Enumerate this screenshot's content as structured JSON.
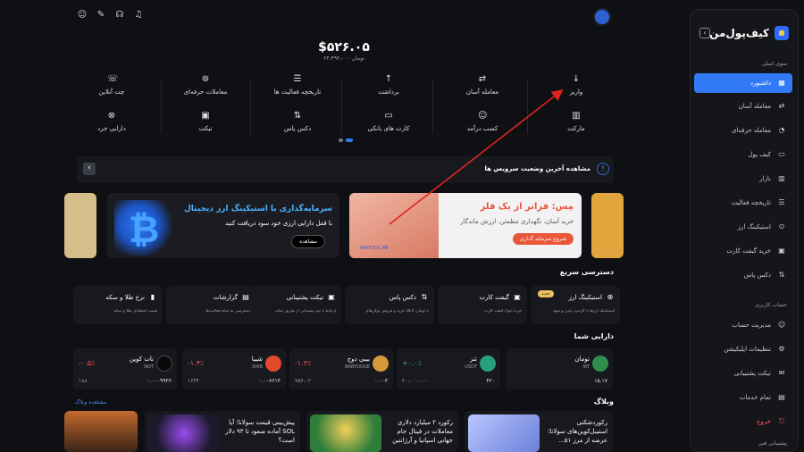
{
  "brand": {
    "name": "کیف‌پول‌من"
  },
  "sidebar": {
    "section_main": "منوی اصلی",
    "items": [
      {
        "label": "داشبورد",
        "icon": "grid-icon"
      },
      {
        "label": "معامله آسان",
        "icon": "swap-icon"
      },
      {
        "label": "معامله حرفه‌ای",
        "icon": "chart-icon"
      },
      {
        "label": "کیف پول",
        "icon": "wallet-icon"
      },
      {
        "label": "بازار",
        "icon": "market-icon"
      },
      {
        "label": "تاریخچه فعالیت",
        "icon": "history-icon"
      },
      {
        "label": "استیکینگ ارز",
        "icon": "stake-icon"
      },
      {
        "label": "خرید گیفت کارت",
        "icon": "gift-icon"
      },
      {
        "label": "دکس پاس",
        "icon": "dex-icon"
      }
    ],
    "section_account": "حساب کاربری",
    "account_items": [
      {
        "label": "مدیریت حساب",
        "icon": "user-icon"
      },
      {
        "label": "تنظیمات اپلیکیشن",
        "icon": "settings-icon"
      },
      {
        "label": "تیکت پشتیبانی",
        "icon": "ticket-icon"
      },
      {
        "label": "تمام خدمات",
        "icon": "apps-icon"
      },
      {
        "label": "خروج",
        "icon": "logout-icon"
      }
    ],
    "section_support": "پشتیبانی فنی"
  },
  "balance": {
    "main": "$۵۲۶.۰۵",
    "sub": "۶۴،۴۹۳،۰۰۰ تومان"
  },
  "actions": [
    {
      "label": "واریز",
      "icon": "arrow-down-icon"
    },
    {
      "label": "معامله آسان",
      "icon": "swap-icon"
    },
    {
      "label": "برداشت",
      "icon": "arrow-up-icon"
    },
    {
      "label": "تاریخچه فعالیت ها",
      "icon": "history-icon"
    },
    {
      "label": "معاملات حرفه‌ای",
      "icon": "pro-icon"
    },
    {
      "label": "چت آنلاین",
      "icon": "chat-icon"
    },
    {
      "label": "مارکت",
      "icon": "market-icon"
    },
    {
      "label": "کسب درآمد",
      "icon": "users-icon"
    },
    {
      "label": "کارت های بانکی",
      "icon": "card-icon"
    },
    {
      "label": "دکس پاس",
      "icon": "dex-icon"
    },
    {
      "label": "تیکت",
      "icon": "ticket-icon"
    },
    {
      "label": "دارایی خرد",
      "icon": "coin-icon"
    }
  ],
  "notice": {
    "title": "مشاهده آخرین وضعیت سرویس ها"
  },
  "banners": {
    "b1": {
      "title": "سرمایه‌گذاری با استیکینگ ارز دیجیتال",
      "sub": "با قفل دارایی ارزی خود سود دریافت کنید",
      "button": "مشاهده"
    },
    "b2": {
      "title": "مِس: فراتر از یک فلز",
      "sub": "خرید آسان، نگهداری مطمئن، ارزش ماندگار",
      "button": "شروع سرمایه گذاری",
      "mark": "RAYPOOL.ME"
    }
  },
  "quick": {
    "title": "دسترسی سریع",
    "items": [
      {
        "title": "استیکینگ ارز",
        "sub": "استیکینگ ارزها با کارمزد پایین و سود",
        "badge": "جدید",
        "icon": "stake-icon"
      },
      {
        "title": "گیفت کارت",
        "sub": "خرید انواع گیفت کارت",
        "badge": "",
        "icon": "gift-icon"
      },
      {
        "title": "دکس پاس",
        "sub": "خرید و فروش توکن‌های DEX با تومان",
        "badge": "",
        "icon": "dex-icon"
      },
      {
        "title": "تیکت پشتیبانی",
        "sub": "ارتباط با تیم پشتیبانی از طریق تیکت",
        "badge": "",
        "icon": "ticket-icon"
      },
      {
        "title": "گزارشات",
        "sub": "دسترسی به تمام فعالیت‌ها",
        "badge": "",
        "icon": "report-icon"
      },
      {
        "title": "نرخ طلا و سکه",
        "sub": "قیمت لحظه‌ای طلا و سکه",
        "badge": "",
        "icon": "gold-icon"
      }
    ]
  },
  "assets": {
    "title": "دارایی شما",
    "items": [
      {
        "name": "تومان",
        "symbol": "IRT",
        "amount": "۱۵.۱۷",
        "price": "",
        "change": "",
        "color": "#2f8f4e"
      },
      {
        "name": "تتر",
        "symbol": "USDT",
        "amount": "۴۲۰",
        "price": "۲۰،۰۰۰،۰۰۰",
        "change": "+۰.۰٪",
        "color": "#26a17b"
      },
      {
        "name": "بیبی دوج",
        "symbol": "BABYDOGE",
        "amount": "۰.۰۰۳",
        "price": "۷۵۶،۰۲",
        "change": "-۱.۳٪",
        "color": "#d69a3a"
      },
      {
        "name": "شیبا",
        "symbol": "SHIB",
        "amount": "۰.۰۰۷۶۱۴",
        "price": "۱۶۴۴",
        "change": "-۱.۴٪",
        "color": "#e24a2d"
      },
      {
        "name": "نات کوین",
        "symbol": "NOT",
        "amount": "۰.۰۰۰۹۹۳۶",
        "price": "۱۸۸",
        "change": "-۰.۵٪",
        "color": "#0a0a0a"
      }
    ]
  },
  "blog": {
    "title": "وبلاگ",
    "more": "مشاهده وبلاگ",
    "items": [
      {
        "title": "رکوردشکنی استیبل‌کوین‌های سولانا؛ عرضه از مرز ۵۱..."
      },
      {
        "title": "رکورد ۲ میلیارد دلاری معاملات در فینال جام جهانی اسپانیا و آرژانتین"
      },
      {
        "title": "پیش‌بینی قیمت سولانا؛ آیا SOL آماده صعود تا ۹۳ دلار است؟"
      }
    ]
  }
}
